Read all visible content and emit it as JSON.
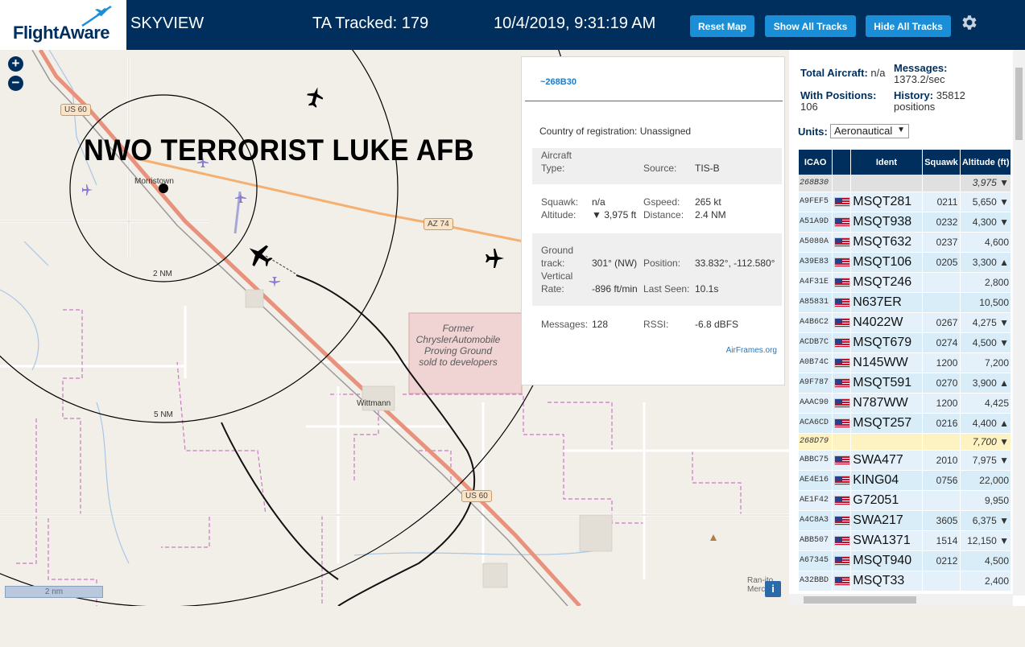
{
  "header": {
    "logo_text": "FlightAware",
    "app_title": "SKYVIEW",
    "ta_tracked": "TA Tracked: 179",
    "datetime": "10/4/2019, 9:31:19 AM",
    "buttons": {
      "reset": "Reset Map",
      "show_all": "Show All Tracks",
      "hide_all": "Hide All Tracks"
    },
    "settings_icon": "gear-icon"
  },
  "map": {
    "overlay_text": "NWO TERRORIST LUKE AFB",
    "labels": {
      "morristown": "Morristown",
      "wittmann": "Wittmann",
      "ring_2nm": "2 NM",
      "ring_5nm": "5 NM",
      "us60_a": "US 60",
      "us60_b": "US 60",
      "az74": "AZ 74",
      "proving_ground": "Former ChryslerAutomobile Proving Ground sold to developers",
      "ranch": "Ran-ito Merc",
      "scale": "2 nm"
    },
    "zoom_in": "+",
    "zoom_out": "−",
    "info": "i"
  },
  "popup": {
    "id": "~268B30",
    "country_label": "Country of registration:",
    "country_value": "Unassigned",
    "aircraft_type_label": "Aircraft Type:",
    "aircraft_type_label_1": "Aircraft",
    "aircraft_type_label_2": "Type:",
    "source_label": "Source:",
    "source_value": "TIS-B",
    "squawk_label": "Squawk:",
    "squawk_value": "n/a",
    "gspeed_label": "Gspeed:",
    "gspeed_value": "265 kt",
    "altitude_label": "Altitude:",
    "altitude_value": "▼ 3,975 ft",
    "distance_label": "Distance:",
    "distance_value": "2.4 NM",
    "ground_label_1": "Ground",
    "ground_label_2": "track:",
    "ground_value": "301° (NW)",
    "position_label": "Position:",
    "position_value": "33.832°, -112.580°",
    "vrate_label_1": "Vertical",
    "vrate_label_2": "Rate:",
    "vrate_value": "-896 ft/min",
    "lastseen_label": "Last Seen:",
    "lastseen_value": "10.1s",
    "messages_label": "Messages:",
    "messages_value": "128",
    "rssi_label": "RSSI:",
    "rssi_value": "-6.8 dBFS",
    "link": "AirFrames.org"
  },
  "panel": {
    "total_label": "Total Aircraft:",
    "total_value": "n/a",
    "messages_label": "Messages:",
    "messages_value": "1373.2/sec",
    "positions_label": "With Positions:",
    "positions_value": "106",
    "history_label": "History:",
    "history_value": "35812 positions",
    "units_label": "Units:",
    "units_value": "Aeronautical",
    "columns": [
      "ICAO",
      "Ident",
      "Squawk",
      "Altitude (ft)"
    ],
    "rows": [
      {
        "icao": "268B30",
        "ident": "",
        "squawk": "",
        "alt": "3,975 ▼",
        "style": "gray",
        "flag": false
      },
      {
        "icao": "A9FEF5",
        "ident": "MSQT281",
        "squawk": "0211",
        "alt": "5,650 ▼",
        "style": "",
        "flag": true
      },
      {
        "icao": "A51A9D",
        "ident": "MSQT938",
        "squawk": "0232",
        "alt": "4,300 ▼",
        "style": "alt",
        "flag": true
      },
      {
        "icao": "A5080A",
        "ident": "MSQT632",
        "squawk": "0237",
        "alt": "4,600",
        "style": "",
        "flag": true
      },
      {
        "icao": "A39E83",
        "ident": "MSQT106",
        "squawk": "0205",
        "alt": "3,300 ▲",
        "style": "alt",
        "flag": true
      },
      {
        "icao": "A4F31E",
        "ident": "MSQT246",
        "squawk": "",
        "alt": "2,800",
        "style": "",
        "flag": true
      },
      {
        "icao": "A85831",
        "ident": "N637ER",
        "squawk": "",
        "alt": "10,500",
        "style": "alt",
        "flag": true
      },
      {
        "icao": "A4B6C2",
        "ident": "N4022W",
        "squawk": "0267",
        "alt": "4,275 ▼",
        "style": "",
        "flag": true
      },
      {
        "icao": "ACDB7C",
        "ident": "MSQT679",
        "squawk": "0274",
        "alt": "4,500 ▼",
        "style": "alt",
        "flag": true
      },
      {
        "icao": "A0B74C",
        "ident": "N145WW",
        "squawk": "1200",
        "alt": "7,200",
        "style": "",
        "flag": true
      },
      {
        "icao": "A9F787",
        "ident": "MSQT591",
        "squawk": "0270",
        "alt": "3,900 ▲",
        "style": "alt",
        "flag": true
      },
      {
        "icao": "AAAC90",
        "ident": "N787WW",
        "squawk": "1200",
        "alt": "4,425",
        "style": "",
        "flag": true
      },
      {
        "icao": "ACA6CD",
        "ident": "MSQT257",
        "squawk": "0216",
        "alt": "4,400 ▲",
        "style": "alt",
        "flag": true
      },
      {
        "icao": "268D79",
        "ident": "",
        "squawk": "",
        "alt": "7,700 ▼",
        "style": "yellow",
        "flag": false
      },
      {
        "icao": "ABBC75",
        "ident": "SWA477",
        "squawk": "2010",
        "alt": "7,975 ▼",
        "style": "",
        "flag": true
      },
      {
        "icao": "AE4E16",
        "ident": "KING04",
        "squawk": "0756",
        "alt": "22,000",
        "style": "alt",
        "flag": true
      },
      {
        "icao": "AE1F42",
        "ident": "G72051",
        "squawk": "",
        "alt": "9,950",
        "style": "",
        "flag": true
      },
      {
        "icao": "A4C8A3",
        "ident": "SWA217",
        "squawk": "3605",
        "alt": "6,375 ▼",
        "style": "alt",
        "flag": true
      },
      {
        "icao": "ABB507",
        "ident": "SWA1371",
        "squawk": "1514",
        "alt": "12,150 ▼",
        "style": "",
        "flag": true
      },
      {
        "icao": "A67345",
        "ident": "MSQT940",
        "squawk": "0212",
        "alt": "4,500",
        "style": "alt",
        "flag": true
      },
      {
        "icao": "A32BBD",
        "ident": "MSQT33",
        "squawk": "",
        "alt": "2,400",
        "style": "",
        "flag": true
      }
    ]
  }
}
